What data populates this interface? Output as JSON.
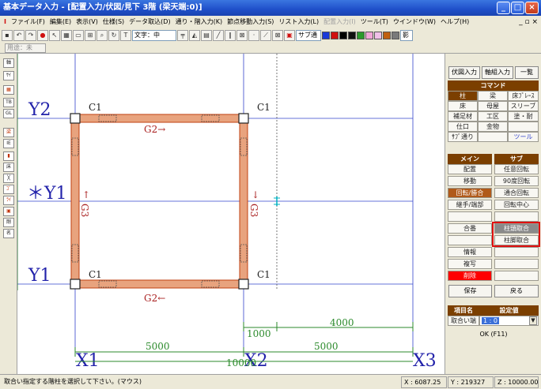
{
  "window": {
    "title": "基本データ入力 - [配置入力/伏図/見下 3階 (梁天端:0)]",
    "controls": [
      "_",
      "□",
      "×"
    ],
    "mdi_controls": "_ ▫ ×"
  },
  "menu": [
    "I",
    "ファイル(F)",
    "編集(E)",
    "表示(V)",
    "仕様(S)",
    "データ取込(D)",
    "通り・階入力(K)",
    "節点移動入力(S)",
    "リスト入力(L)",
    "配置入力(I)",
    "ツール(T)",
    "ウインドウ(W)",
    "ヘルプ(H)"
  ],
  "toolbar": {
    "font_combo": "文字：中",
    "sub_label": "サブ通",
    "shadow_label": "影",
    "swatches": [
      "#1a3ad8",
      "#d01010",
      "#000000",
      "#111111",
      "#2b9a2b",
      "#f2a6d8",
      "#f0c0e8",
      "#c06010",
      "#7a7a7a"
    ]
  },
  "toolbar2": {
    "combo": "用途：未"
  },
  "left_tools": [
    "軸",
    "ｻｲ",
    "▦",
    "TB",
    "GL",
    "梁",
    "IE",
    "▮",
    "床",
    "╳",
    "ｺﾞ",
    "ﾗｲ",
    "▣",
    "剛",
    "名"
  ],
  "plan": {
    "axes_y": [
      "Y2",
      "＊Y1",
      "Y1"
    ],
    "axes_x": [
      "X1",
      "X2",
      "X3"
    ],
    "columns": [
      "C1",
      "C1",
      "C1",
      "C1"
    ],
    "girders": [
      "G2→",
      "G2←",
      "↓\nG3",
      "↓\nG3"
    ],
    "girder_labels": {
      "top": "G2→",
      "bottom": "G2←",
      "left": "G3",
      "right": "G3",
      "left_arrow": "↑",
      "right_arrow": "↓"
    },
    "dims": {
      "span1": "5000",
      "span2": "5000",
      "total": "10000",
      "sub1": "1000",
      "sub2": "4000"
    }
  },
  "panel": {
    "top_buttons": [
      "伏図入力",
      "軸組入力",
      "一覧"
    ],
    "command_header": "コマンド",
    "command_cells": [
      "柱",
      "梁",
      "床ﾌﾞﾚｰｽ",
      "床",
      "母屋",
      "スリーブ",
      "補足材",
      "工区",
      "塗・耐",
      "仕口",
      "金物",
      "",
      "ｻﾌﾞ通り",
      "",
      "ツール"
    ],
    "main_header": "メイン",
    "sub_header": "サブ",
    "main_items": [
      "配置",
      "移動",
      "回転/勝合",
      "継手/端部",
      "",
      "合番",
      "",
      "情報",
      "複写",
      "削除"
    ],
    "sub_items": [
      "任意回転",
      "90度回転",
      "通合回転",
      "回転中心",
      "",
      "柱頭取合",
      "柱脚取合",
      "",
      "",
      ""
    ],
    "save": "保存",
    "back": "戻る",
    "table_header_name": "項目名",
    "table_header_value": "設定値",
    "row_name": "取合い端",
    "row_value": "1 : 0",
    "ok": "OK (F11)"
  },
  "status": {
    "message": "取合い指定する階柱を選択して下さい。(マウス)",
    "x": "X : 6087.25",
    "y": "Y : 219327",
    "z": "Z : 10000.00"
  },
  "colors": {
    "titlebar": "#1f4fc9",
    "axis_blue": "#3344cc",
    "dim_green": "#2b8a2b",
    "girder_fill": "#e8a37e",
    "girder_stroke": "#c04010",
    "label_blue": "#2222aa",
    "label_red": "#aa2222",
    "highlight": "#e01010",
    "delete_red": "#ff0000"
  }
}
